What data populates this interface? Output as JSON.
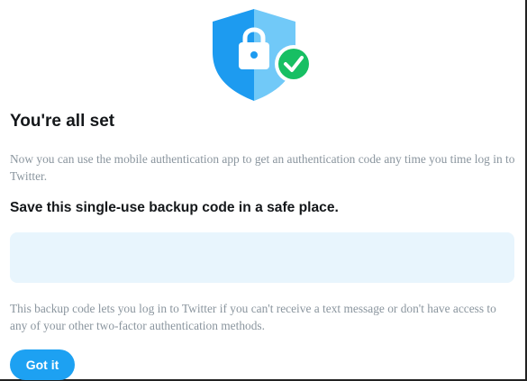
{
  "header": {
    "icon": "shield-lock-check-icon"
  },
  "main": {
    "title": "You're all set",
    "description": "Now you can use the mobile authentication app to get an authentication code any time you time log in to Twitter.",
    "backup_heading": "Save this single-use backup code in a safe place.",
    "backup_code": "",
    "backup_note": "This backup code lets you log in to Twitter if you can't receive a text message or don't have access to any of your other two-factor authentication methods."
  },
  "actions": {
    "got_it_label": "Got it"
  },
  "colors": {
    "accent": "#1da1f2",
    "shield_dark": "#1d9bf0",
    "shield_light": "#71c9f8",
    "check_green": "#17bf63",
    "code_box_bg": "#e8f5fd",
    "muted_text": "#8a959e"
  }
}
